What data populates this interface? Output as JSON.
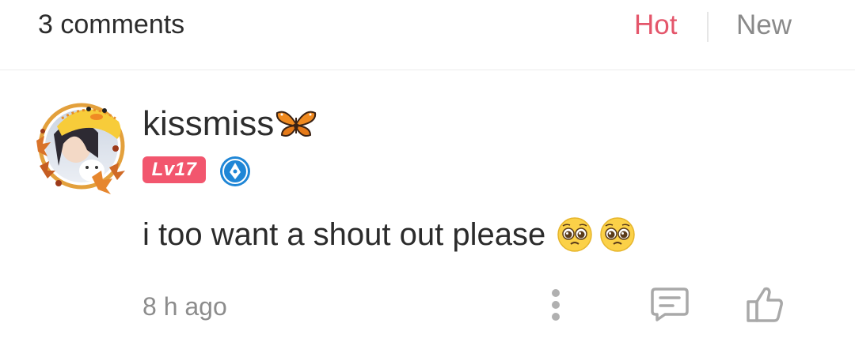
{
  "header": {
    "comment_count_label": "3 comments",
    "sort_tabs": [
      {
        "label": "Hot",
        "active": true
      },
      {
        "label": "New",
        "active": false
      }
    ],
    "active_color": "#e4566b"
  },
  "comment": {
    "username": "kissmiss",
    "name_decoration_icon": "butterfly-icon",
    "level_badge": "Lv17",
    "verified_icon": "pen-nib-badge-icon",
    "text": "i too want a shout out please",
    "emojis": [
      "pleading-face-emoji",
      "pleading-face-emoji"
    ],
    "timestamp": "8 h ago",
    "actions": [
      "more-options-icon",
      "reply-icon",
      "like-icon"
    ]
  }
}
